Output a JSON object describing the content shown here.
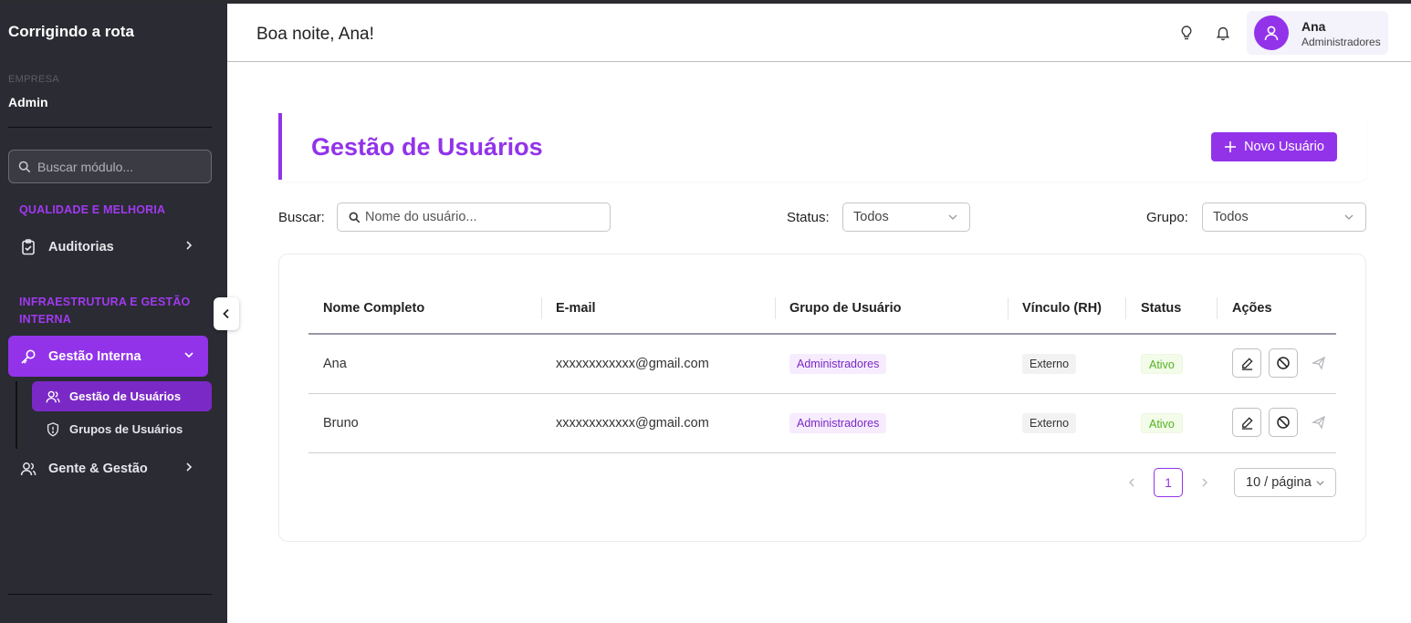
{
  "sidebar": {
    "brand": "Corrigindo a rota",
    "company_label": "EMPRESA",
    "company_name": "Admin",
    "search_placeholder": "Buscar módulo...",
    "sections": [
      {
        "title": "QUALIDADE E MELHORIA"
      },
      {
        "title": "INFRAESTRUTURA E GESTÃO INTERNA"
      }
    ],
    "items": [
      {
        "label": "Auditorias",
        "icon": "clipboard-check-icon"
      },
      {
        "label": "Gestão Interna",
        "icon": "key-icon",
        "expanded": true
      },
      {
        "label": "Gente & Gestão",
        "icon": "users-icon"
      }
    ],
    "subitems": [
      {
        "label": "Gestão de Usuários",
        "icon": "users-icon",
        "active": true
      },
      {
        "label": "Grupos de Usuários",
        "icon": "shield-alert-icon"
      }
    ]
  },
  "header": {
    "greeting": "Boa noite, Ana!",
    "user_name": "Ana",
    "user_role": "Administradores"
  },
  "page": {
    "title": "Gestão de Usuários",
    "new_button": "Novo Usuário",
    "accent_color": "#9233ea"
  },
  "filters": {
    "search_label": "Buscar:",
    "search_placeholder": "Nome do usuário...",
    "status_label": "Status:",
    "status_value": "Todos",
    "group_label": "Grupo:",
    "group_value": "Todos"
  },
  "table": {
    "columns": [
      "Nome Completo",
      "E-mail",
      "Grupo de Usuário",
      "Vínculo (RH)",
      "Status",
      "Ações"
    ],
    "rows": [
      {
        "name": "Ana",
        "email": "xxxxxxxxxxxx@gmail.com",
        "group": "Administradores",
        "vinculo": "Externo",
        "status": "Ativo"
      },
      {
        "name": "Bruno",
        "email": "xxxxxxxxxxxx@gmail.com",
        "group": "Administradores",
        "vinculo": "Externo",
        "status": "Ativo"
      }
    ]
  },
  "pagination": {
    "current_page": "1",
    "page_size": "10 / página"
  }
}
